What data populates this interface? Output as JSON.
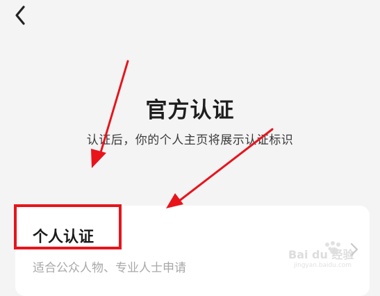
{
  "header": {
    "back_icon": "chevron-left-icon"
  },
  "main": {
    "title": "官方认证",
    "subtitle": "认证后，你的个人主页将展示认证标识"
  },
  "card": {
    "title": "个人认证",
    "description": "适合公众人物、专业人士申请",
    "chevron_icon": "chevron-right-icon"
  },
  "annotations": {
    "arrow_color": "#e8141c",
    "box_color": "#e8141c"
  },
  "watermark": {
    "logo": "baidu-jingyan-logo",
    "text": "Bai du 经验",
    "url": "jingyan.baidu.com"
  },
  "colors": {
    "background": "#f4f4f4",
    "card": "#ffffff",
    "title": "#1e1e1e",
    "muted": "#a8a8a8"
  }
}
